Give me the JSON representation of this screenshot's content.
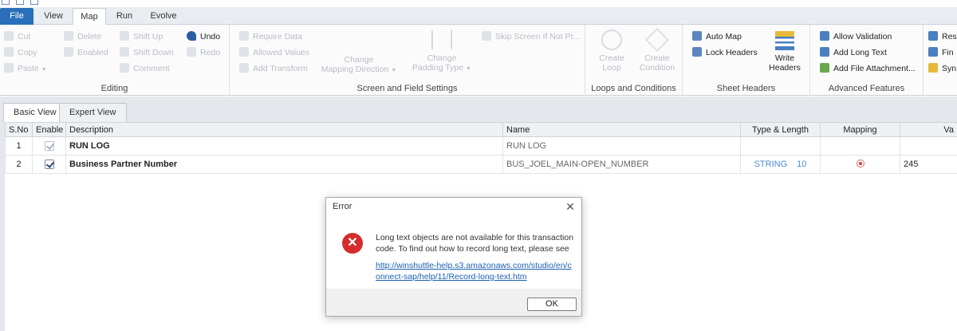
{
  "menu": {
    "tabs": [
      "File",
      "View",
      "Map",
      "Run",
      "Evolve"
    ],
    "active": "Map"
  },
  "ribbon": {
    "editing": {
      "title": "Editing",
      "cut": "Cut",
      "copy": "Copy",
      "paste": "Paste",
      "delete": "Delete",
      "enabled": "Enabled",
      "comment": "Comment",
      "shift_up": "Shift Up",
      "shift_down": "Shift Down",
      "undo": "Undo",
      "redo": "Redo"
    },
    "screen_field": {
      "title": "Screen and Field Settings",
      "require_data": "Require Data",
      "allowed_values": "Allowed Values",
      "add_transform": "Add Transform",
      "change_mapping_direction_1": "Change",
      "change_mapping_direction_2": "Mapping Direction",
      "change_padding_type_1": "Change",
      "change_padding_type_2": "Padding Type",
      "skip_screen": "Skip Screen If Not Pr..."
    },
    "loops": {
      "title": "Loops and Conditions",
      "create_loop_1": "Create",
      "create_loop_2": "Loop",
      "create_condition_1": "Create",
      "create_condition_2": "Condition"
    },
    "sheet_headers": {
      "title": "Sheet Headers",
      "auto_map": "Auto Map",
      "lock_headers": "Lock Headers",
      "write_headers_1": "Write",
      "write_headers_2": "Headers"
    },
    "advanced": {
      "title": "Advanced Features",
      "allow_validation": "Allow Validation",
      "add_long_text": "Add Long Text",
      "add_file_attachment": "Add File Attachment..."
    },
    "extra": {
      "item1": "Res",
      "item2": "Fin",
      "item3": "Syn"
    }
  },
  "views": {
    "basic": "Basic View",
    "expert": "Expert View"
  },
  "grid": {
    "headers": [
      "S.No",
      "Enable",
      "Description",
      "Name",
      "Type & Length",
      "Mapping",
      "Va"
    ],
    "rows": [
      {
        "sno": "1",
        "desc": "RUN LOG",
        "name": "RUN LOG",
        "type": "",
        "length": "",
        "value": ""
      },
      {
        "sno": "2",
        "desc": "Business Partner Number",
        "name": "BUS_JOEL_MAIN-OPEN_NUMBER",
        "type": "STRING",
        "length": "10",
        "value": "245"
      }
    ]
  },
  "dialog": {
    "title": "Error",
    "message": "Long text objects are not available for this transaction code. To find out how to record long text, please see",
    "link": "http://winshuttle-help.s3.amazonaws.com/studio/en/connect-sap/help/11/Record-long-text.htm",
    "ok": "OK"
  },
  "colors": {
    "accent": "#2a6fb9",
    "error": "#d42c2c",
    "link": "#1a5fb4"
  }
}
